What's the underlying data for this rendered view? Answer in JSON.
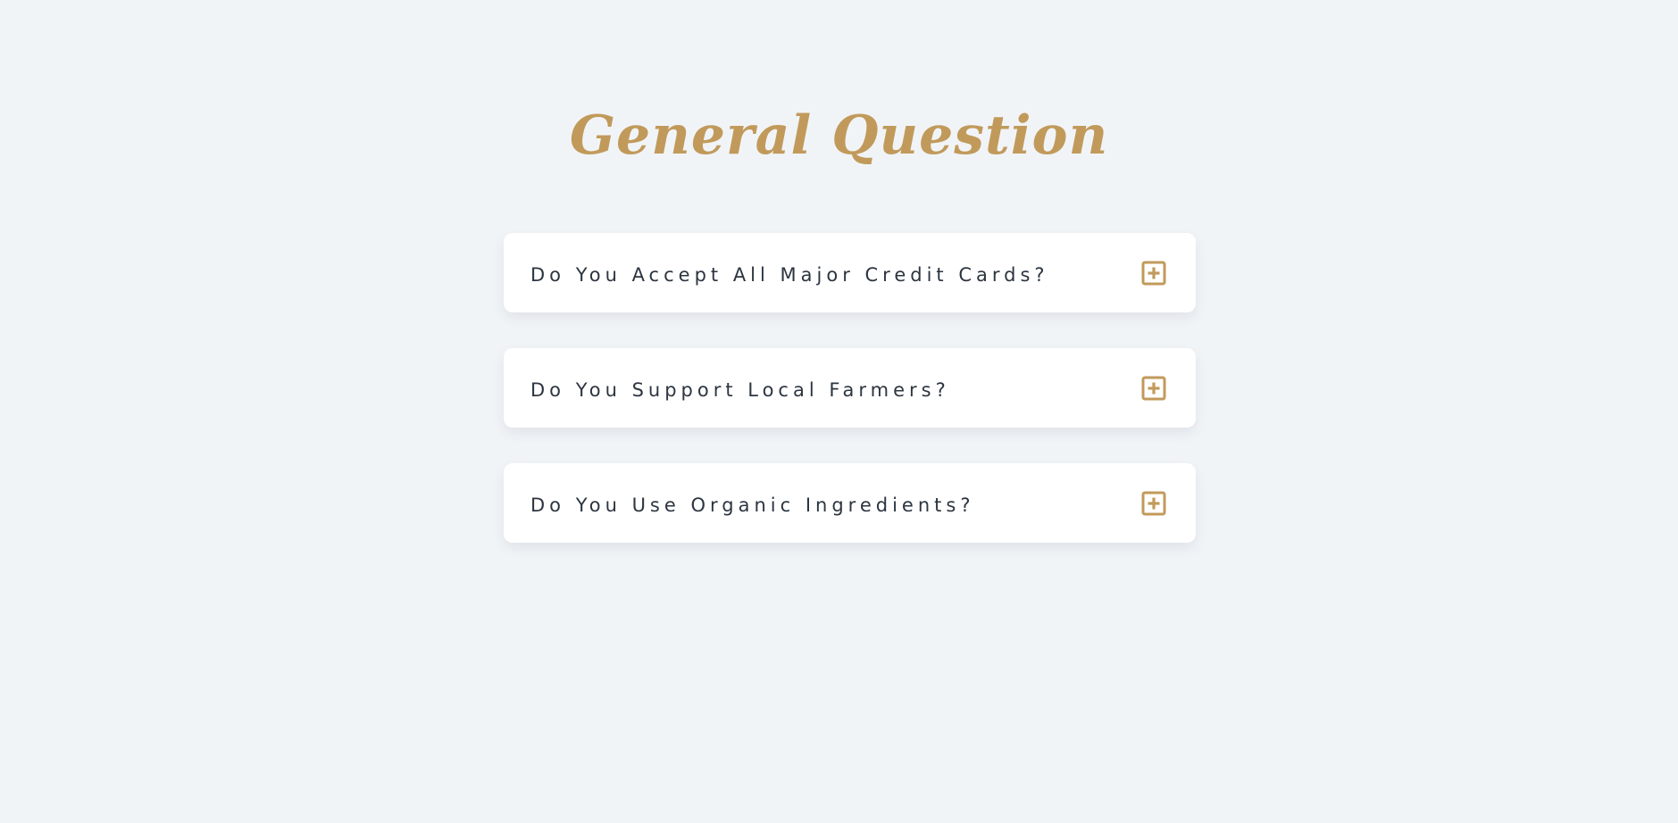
{
  "page": {
    "title": "General Question"
  },
  "faq": {
    "items": [
      {
        "question": "Do You Accept All Major Credit Cards?",
        "toggle_icon": "plus-square-icon"
      },
      {
        "question": "Do You Support Local Farmers?",
        "toggle_icon": "plus-square-icon"
      },
      {
        "question": "Do You Use Organic Ingredients?",
        "toggle_icon": "plus-square-icon"
      }
    ]
  },
  "colors": {
    "background": "#f1f4f7",
    "accent": "#c19a5b",
    "card": "#ffffff",
    "text": "#2c3540"
  }
}
